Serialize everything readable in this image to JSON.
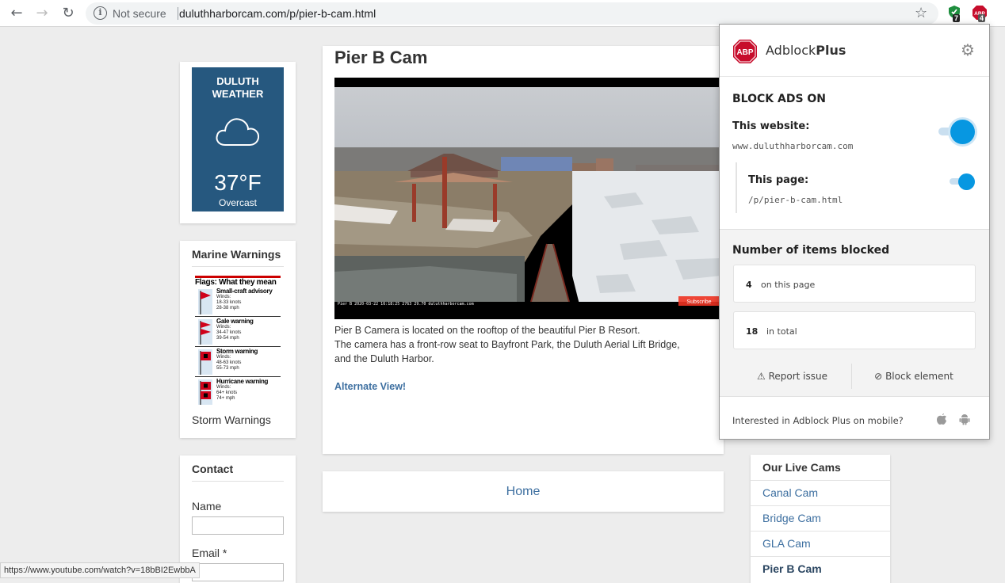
{
  "browser": {
    "security_label": "Not secure",
    "url": "duluthharborcam.com/p/pier-b-cam.html",
    "ext_badge_green": "7",
    "ext_badge_abp": "4",
    "status_url": "https://www.youtube.com/watch?v=18bBI2EwbbA"
  },
  "weather": {
    "city": "DULUTH",
    "subtitle": "WEATHER",
    "temperature": "37°F",
    "condition": "Overcast"
  },
  "marine": {
    "title": "Marine Warnings",
    "flags_heading": "Flags: What they mean",
    "flags": [
      {
        "name": "Small-craft advisory",
        "winds": "Winds:",
        "knots": "18-33 knots",
        "mph": "28-38 mph"
      },
      {
        "name": "Gale warning",
        "winds": "Winds:",
        "knots": "34-47 knots",
        "mph": "39-54 mph"
      },
      {
        "name": "Storm warning",
        "winds": "Winds:",
        "knots": "48-63 knots",
        "mph": "55-73 mph"
      },
      {
        "name": "Hurricane warning",
        "winds": "Winds:",
        "knots": "64+ knots",
        "mph": "74+ mph"
      }
    ],
    "caption": "Storm Warnings"
  },
  "contact": {
    "title": "Contact",
    "name_label": "Name",
    "email_label": "Email *"
  },
  "main": {
    "title": "Pier B Cam",
    "video_overlay": "Pier B  2020-03-22   16:18:25   2763 29.70  duluthharborcam.com",
    "subscribe": "Subscribe",
    "desc_line1": "Pier B Camera is located on the rooftop of the beautiful Pier B Resort.",
    "desc_line2": "The camera has a front-row seat to Bayfront Park, the Duluth Aerial Lift Bridge,",
    "desc_line3": "and the Duluth Harbor.",
    "alt_link": "Alternate View!"
  },
  "home": {
    "label": "Home"
  },
  "cams": {
    "title": "Our Live Cams",
    "items": [
      "Canal Cam",
      "Bridge Cam",
      "GLA Cam",
      "Pier B Cam"
    ]
  },
  "adblock": {
    "brand_light": "Adblock",
    "brand_bold": "Plus",
    "block_title": "BLOCK ADS ON",
    "website_label": "This website:",
    "website_domain": "www.duluthharborcam.com",
    "page_label": "This page:",
    "page_path": "/p/pier-b-cam.html",
    "stats_title": "Number of items blocked",
    "page_count": "4",
    "page_count_label": "on this page",
    "total_count": "18",
    "total_count_label": "in total",
    "report_label": "Report issue",
    "block_label": "Block element",
    "mobile_text": "Interested in Adblock Plus on mobile?",
    "accent": "#0797e1",
    "website_enabled": true,
    "page_enabled": true
  }
}
